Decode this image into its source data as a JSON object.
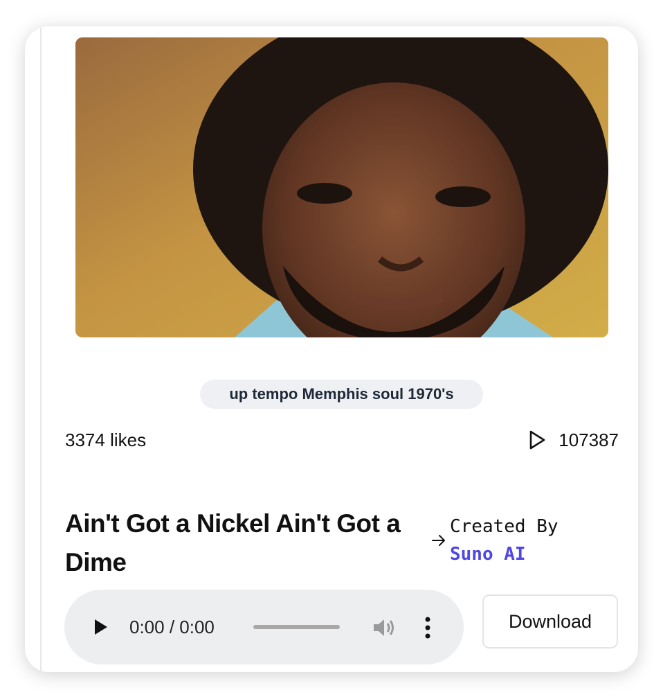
{
  "song": {
    "tag": "up tempo Memphis soul 1970's",
    "likes_text": "3374 likes",
    "plays": "107387",
    "title": "Ain't Got a Nickel Ain't Got a Dime"
  },
  "creator": {
    "label": "Created By",
    "name": "Suno AI"
  },
  "player": {
    "time": "0:00 / 0:00"
  },
  "actions": {
    "download_label": "Download"
  },
  "colors": {
    "accent": "#4f46e5",
    "tag_bg": "#eef0f3",
    "player_bg": "#eceef0"
  },
  "icons": [
    "play-icon",
    "arrow-right-icon",
    "volume-icon",
    "more-vertical-icon"
  ]
}
